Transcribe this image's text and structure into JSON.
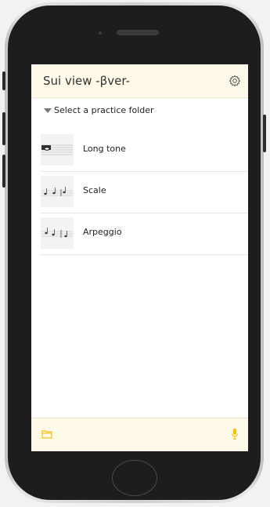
{
  "app": {
    "title": "Sui view -βver-"
  },
  "folder_selector": {
    "label": "Select a practice folder"
  },
  "practice_items": [
    {
      "label": "Long tone",
      "icon": "whole-note-staff-icon"
    },
    {
      "label": "Scale",
      "icon": "scale-notes-icon"
    },
    {
      "label": "Arpeggio",
      "icon": "arpeggio-notes-icon"
    }
  ],
  "footer": {
    "left_icon": "folder-icon",
    "right_icon": "microphone-icon"
  },
  "colors": {
    "accent": "#f5c400",
    "header_bg": "#fef9e8",
    "phone_body": "#1d1d1f"
  }
}
